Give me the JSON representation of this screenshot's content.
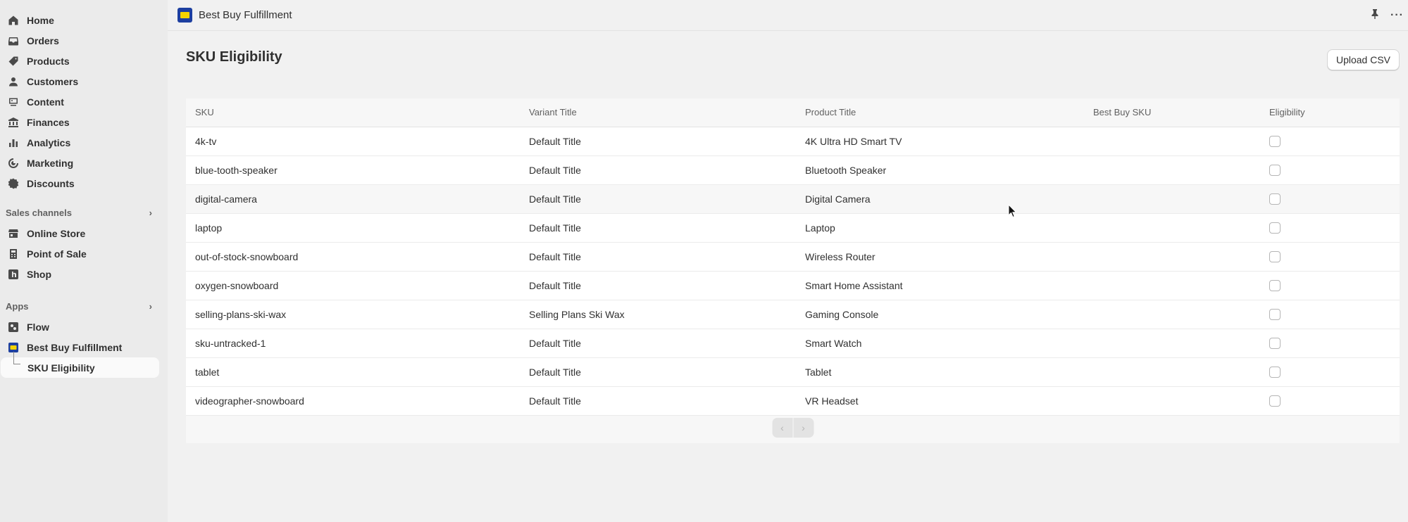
{
  "sidebar": {
    "items": [
      {
        "label": "Home",
        "icon": "home-icon"
      },
      {
        "label": "Orders",
        "icon": "inbox-icon"
      },
      {
        "label": "Products",
        "icon": "tag-icon"
      },
      {
        "label": "Customers",
        "icon": "person-icon"
      },
      {
        "label": "Content",
        "icon": "content-icon"
      },
      {
        "label": "Finances",
        "icon": "bank-icon"
      },
      {
        "label": "Analytics",
        "icon": "bar-chart-icon"
      },
      {
        "label": "Marketing",
        "icon": "target-icon"
      },
      {
        "label": "Discounts",
        "icon": "discount-icon"
      }
    ],
    "sales_channels_label": "Sales channels",
    "sales_channels": [
      {
        "label": "Online Store",
        "icon": "store-icon"
      },
      {
        "label": "Point of Sale",
        "icon": "pos-icon"
      },
      {
        "label": "Shop",
        "icon": "shop-icon"
      }
    ],
    "apps_label": "Apps",
    "apps": [
      {
        "label": "Flow",
        "icon": "flow-icon"
      },
      {
        "label": "Best Buy Fulfillment",
        "icon": "bestbuy-logo-icon"
      }
    ],
    "active_sub": "SKU Eligibility"
  },
  "topbar": {
    "app_title": "Best Buy Fulfillment"
  },
  "main": {
    "page_title": "SKU Eligibility",
    "upload_button": "Upload CSV",
    "columns": [
      "SKU",
      "Variant Title",
      "Product Title",
      "Best Buy SKU",
      "Eligibility"
    ],
    "rows": [
      {
        "sku": "4k-tv",
        "variant": "Default Title",
        "product": "4K Ultra HD Smart TV",
        "bb_sku": "",
        "eligible": false
      },
      {
        "sku": "blue-tooth-speaker",
        "variant": "Default Title",
        "product": "Bluetooth Speaker",
        "bb_sku": "",
        "eligible": false
      },
      {
        "sku": "digital-camera",
        "variant": "Default Title",
        "product": "Digital Camera",
        "bb_sku": "",
        "eligible": false
      },
      {
        "sku": "laptop",
        "variant": "Default Title",
        "product": "Laptop",
        "bb_sku": "",
        "eligible": false
      },
      {
        "sku": "out-of-stock-snowboard",
        "variant": "Default Title",
        "product": "Wireless Router",
        "bb_sku": "",
        "eligible": false
      },
      {
        "sku": "oxygen-snowboard",
        "variant": "Default Title",
        "product": "Smart Home Assistant",
        "bb_sku": "",
        "eligible": false
      },
      {
        "sku": "selling-plans-ski-wax",
        "variant": "Selling Plans Ski Wax",
        "product": "Gaming Console",
        "bb_sku": "",
        "eligible": false
      },
      {
        "sku": "sku-untracked-1",
        "variant": "Default Title",
        "product": "Smart Watch",
        "bb_sku": "",
        "eligible": false
      },
      {
        "sku": "tablet",
        "variant": "Default Title",
        "product": "Tablet",
        "bb_sku": "",
        "eligible": false
      },
      {
        "sku": "videographer-snowboard",
        "variant": "Default Title",
        "product": "VR Headset",
        "bb_sku": "",
        "eligible": false
      }
    ],
    "pager": {
      "prev": "‹",
      "next": "›"
    }
  }
}
